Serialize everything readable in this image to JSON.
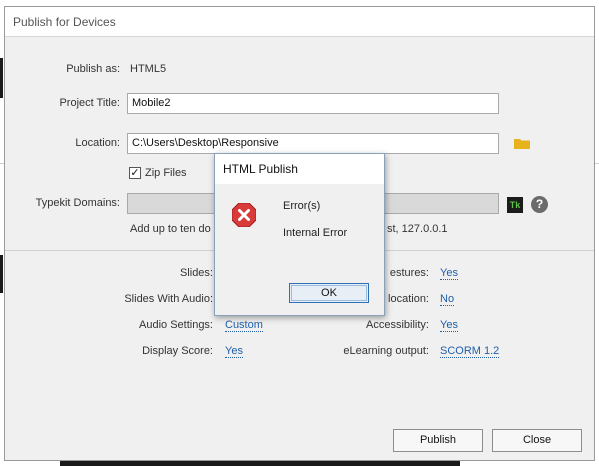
{
  "dialog": {
    "title": "Publish for Devices",
    "publish_as": {
      "label": "Publish as:",
      "value": "HTML5"
    },
    "project_title": {
      "label": "Project Title:",
      "value": "Mobile2"
    },
    "location": {
      "label": "Location:",
      "value": "C:\\Users\\Desktop\\Responsive"
    },
    "zip_files": {
      "label": "Zip Files",
      "checked": true,
      "mark": "✓"
    },
    "typekit": {
      "label": "Typekit Domains:",
      "value": "",
      "hint_left": "Add up to ten do",
      "hint_right": "st, 127.0.0.1",
      "tk_label": "Tk",
      "help_glyph": "?"
    },
    "options": {
      "slides": {
        "label": "Slides:"
      },
      "slides_with_audio": {
        "label": "Slides With Audio:"
      },
      "audio_settings": {
        "label": "Audio Settings:",
        "value": "Custom"
      },
      "display_score": {
        "label": "Display Score:",
        "value": "Yes"
      },
      "gestures": {
        "label": "estures:",
        "value": "Yes"
      },
      "geolocation": {
        "label": "location:",
        "value": "No"
      },
      "accessibility": {
        "label": "Accessibility:",
        "value": "Yes"
      },
      "elearning_output": {
        "label": "eLearning output:",
        "value": "SCORM 1.2"
      }
    },
    "buttons": {
      "publish": "Publish",
      "close": "Close"
    }
  },
  "modal": {
    "title": "HTML Publish",
    "line1": "Error(s)",
    "line2": "Internal Error",
    "ok": "OK"
  },
  "colors": {
    "link": "#1f5fa8",
    "error_icon": "#d93a3a",
    "folder_icon": "#e8b21c",
    "typekit_icon_fg": "#5ec24a"
  },
  "icons": [
    "folder-icon",
    "typekit-icon",
    "help-icon",
    "error-icon"
  ]
}
